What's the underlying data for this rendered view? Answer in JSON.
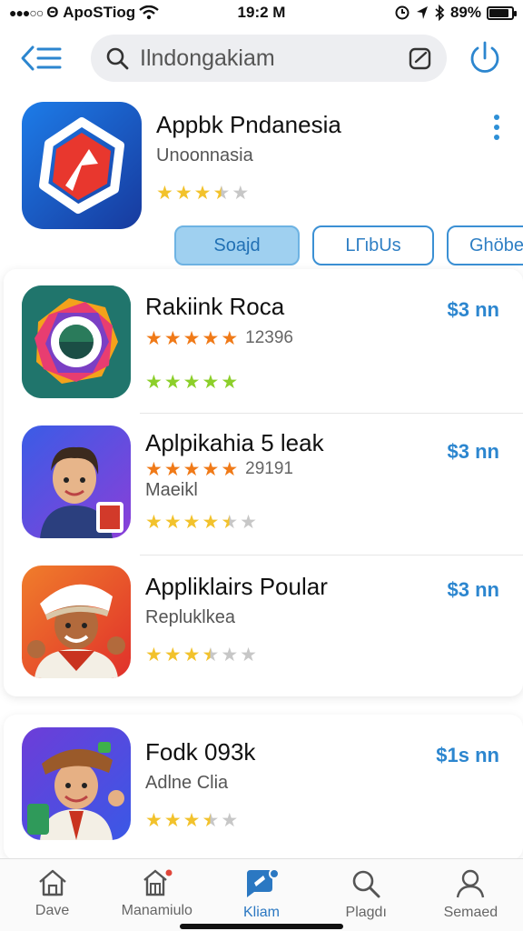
{
  "status_bar": {
    "carrier": "Θ ApoSTiog",
    "time": "19:2 M",
    "battery": "89%"
  },
  "header": {
    "search_placeholder": "Ilndongakiam"
  },
  "featured": {
    "title": "Appbk Pndanesia",
    "subtitle": "Unoonnasia",
    "rating": 3.5,
    "pills": [
      "Soajd",
      "LΓιbUs",
      "Ghöbe"
    ]
  },
  "apps": [
    {
      "title": "Rakiink Roca",
      "count": "12396",
      "price": "$3 nn",
      "orange_stars": 5,
      "rating_green": 5
    },
    {
      "title": "Aplpikahia 5 leak",
      "count": "29191",
      "subtitle": "Maeikl",
      "price": "$3 nn",
      "orange_stars": 5,
      "rating": 4.5
    },
    {
      "title": "Appliklairs Poular",
      "subtitle": "Repluklkea",
      "price": "$3 nn",
      "rating": 3.5
    },
    {
      "title": "Fodk 093k",
      "subtitle": "Adlne Clia",
      "price": "$1s nn",
      "rating": 3.5
    }
  ],
  "tabs": [
    {
      "label": "Dave",
      "icon": "home-icon"
    },
    {
      "label": "Manamiulo",
      "icon": "store-icon"
    },
    {
      "label": "Kliam",
      "icon": "chat-icon"
    },
    {
      "label": "Plagdı",
      "icon": "search-icon"
    },
    {
      "label": "Semaed",
      "icon": "profile-icon"
    }
  ],
  "colors": {
    "accent": "#2c86cf",
    "star": "#f2c22c",
    "star_green": "#8ccf2a",
    "star_orange": "#f07a18"
  }
}
